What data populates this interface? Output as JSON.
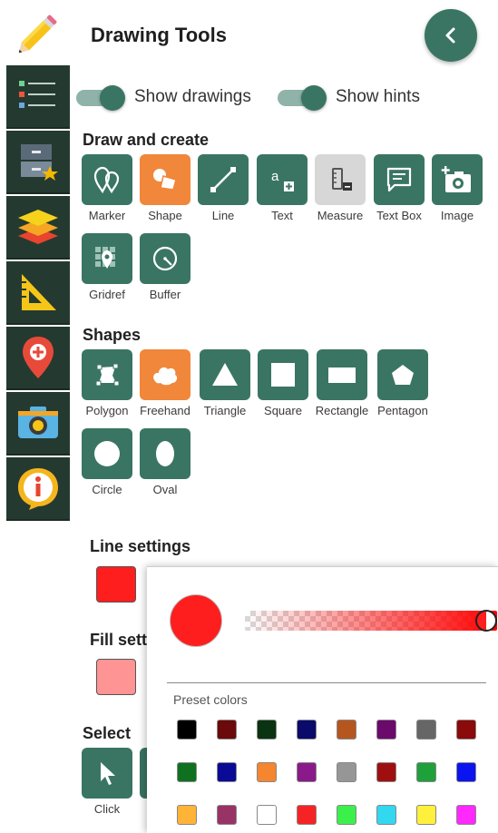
{
  "panel": {
    "title": "Drawing Tools",
    "toggles": [
      {
        "label": "Show drawings",
        "on": true
      },
      {
        "label": "Show hints",
        "on": true
      }
    ]
  },
  "sections": {
    "draw_create": "Draw and create",
    "shapes": "Shapes",
    "line_settings": "Line settings",
    "fill_settings": "Fill sett",
    "select": "Select"
  },
  "draw_tools": [
    {
      "label": "Marker",
      "icon": "marker-icon"
    },
    {
      "label": "Shape",
      "icon": "shape-icon",
      "active": true
    },
    {
      "label": "Line",
      "icon": "line-icon"
    },
    {
      "label": "Text",
      "icon": "text-icon"
    },
    {
      "label": "Measure",
      "icon": "measure-icon",
      "disabled": true
    },
    {
      "label": "Text Box",
      "icon": "text-box-icon"
    },
    {
      "label": "Image",
      "icon": "image-icon"
    },
    {
      "label": "Gridref",
      "icon": "gridref-icon"
    },
    {
      "label": "Buffer",
      "icon": "buffer-icon"
    }
  ],
  "shape_tools": [
    {
      "label": "Polygon",
      "icon": "polygon-icon"
    },
    {
      "label": "Freehand",
      "icon": "freehand-icon",
      "active": true
    },
    {
      "label": "Triangle",
      "icon": "triangle-icon"
    },
    {
      "label": "Square",
      "icon": "square-icon"
    },
    {
      "label": "Rectangle",
      "icon": "rectangle-icon"
    },
    {
      "label": "Pentagon",
      "icon": "pentagon-icon"
    },
    {
      "label": "Circle",
      "icon": "circle-icon"
    },
    {
      "label": "Oval",
      "icon": "oval-icon"
    }
  ],
  "select_tools": [
    {
      "label": "Click",
      "icon": "pointer-icon"
    }
  ],
  "colors": {
    "accent": "#3a7563",
    "active": "#f0873a",
    "line_color": "#ff1e1e",
    "fill_color": "#ff9494"
  },
  "picker": {
    "current_color": "#ff1e1e",
    "preset_label": "Preset colors",
    "presets": [
      "#000000",
      "#6b0a0a",
      "#0a3311",
      "#0a0a6b",
      "#b5561f",
      "#6b0a6b",
      "#666666",
      "#8b0a0a",
      "#0f7020",
      "#0a0a96",
      "#f5852f",
      "#8a1a8a",
      "#969696",
      "#a00f0f",
      "#1ea03a",
      "#0a14f0",
      "#ffb437",
      "#993366",
      "#ffffff",
      "#f52323",
      "#3cf04b",
      "#32d7f0",
      "#fff03c",
      "#ff28ff"
    ]
  },
  "rail": {
    "items": [
      "pencil-logo-icon",
      "legend-list-icon",
      "saved-drawer-icon",
      "layers-icon",
      "measure-triangle-icon",
      "location-add-icon",
      "camera-icon",
      "info-icon"
    ]
  }
}
